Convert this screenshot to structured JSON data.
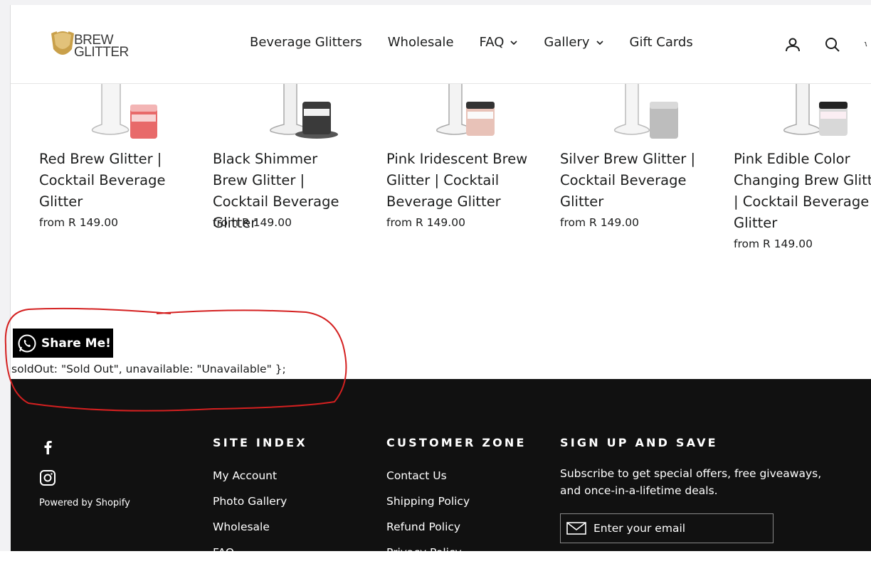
{
  "header": {
    "logo": {
      "line1": "BREW",
      "line2": "GLITTER"
    },
    "nav": [
      {
        "label": "Beverage Glitters",
        "has_dropdown": false
      },
      {
        "label": "Wholesale",
        "has_dropdown": false
      },
      {
        "label": "FAQ",
        "has_dropdown": true
      },
      {
        "label": "Gallery",
        "has_dropdown": true
      },
      {
        "label": "Gift Cards",
        "has_dropdown": false
      }
    ],
    "icons": [
      "account-icon",
      "search-icon",
      "cart-icon"
    ]
  },
  "products": [
    {
      "title": "Red Brew Glitter | Cocktail Beverage Glitter",
      "price": "from R 149.00",
      "jar_color": "#e86a6a"
    },
    {
      "title": "Black Shimmer Brew Glitter | Cocktail Beverage Glitter",
      "price": "from R 149.00",
      "jar_color": "#3a3a3a"
    },
    {
      "title": "Pink Iridescent Brew Glitter | Cocktail Beverage Glitter",
      "price": "from R 149.00",
      "jar_color": "#e8c2b8"
    },
    {
      "title": "Silver Brew Glitter | Cocktail Beverage Glitter",
      "price": "from R 149.00",
      "jar_color": "#bdbdbd"
    },
    {
      "title": "Pink Edible Color Changing Brew Glitter | Cocktail Beverage Glitter",
      "price": "from R 149.00",
      "jar_color": "#d8d8d8"
    }
  ],
  "share": {
    "label": "Share Me!"
  },
  "code_text": "soldOut: \"Sold Out\", unavailable: \"Unavailable\" };",
  "footer": {
    "powered_by": "Powered by Shopify",
    "site_index": {
      "title": "SITE INDEX",
      "links": [
        "My Account",
        "Photo Gallery",
        "Wholesale",
        "FAQ"
      ]
    },
    "customer_zone": {
      "title": "CUSTOMER ZONE",
      "links": [
        "Contact Us",
        "Shipping Policy",
        "Refund Policy",
        "Privacy Policy"
      ]
    },
    "signup": {
      "title": "SIGN UP AND SAVE",
      "text": "Subscribe to get special offers, free giveaways, and once-in-a-lifetime deals.",
      "email_placeholder": "Enter your email"
    }
  },
  "colors": {
    "footer_bg": "#111111",
    "logo_gold": "#c9a04a",
    "annotation_red": "#d42020",
    "text": "#1c1d1d"
  }
}
